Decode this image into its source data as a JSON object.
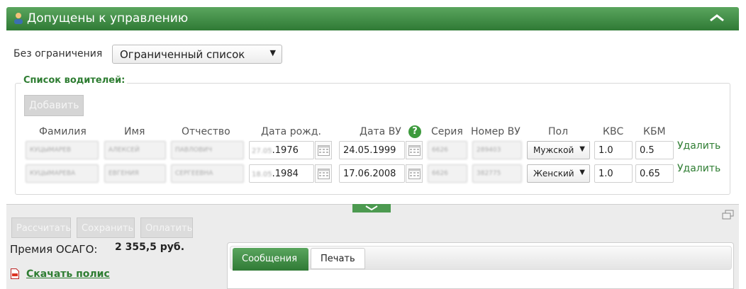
{
  "panel": {
    "title": "Допущены к управлению"
  },
  "restriction": {
    "label": "Без ограничения",
    "selected": "Ограниченный список"
  },
  "drivers": {
    "legend": "Список водителей:",
    "add_label": "Добавить",
    "columns": [
      "Фамилия",
      "Имя",
      "Отчество",
      "Дата рожд.",
      "Дата ВУ",
      "Серия",
      "Номер ВУ",
      "Пол",
      "КВС",
      "КБМ"
    ],
    "rows": [
      {
        "lastname": "КУЦЫМАРЕВ",
        "firstname": "АЛЕКСЕЙ",
        "middlename": "ПАВЛОВИЧ",
        "birth_dm": "27.05",
        "birth_y": ".1976",
        "license_date": "24.05.1999",
        "series": "6626",
        "number": "289403",
        "gender": "Мужской",
        "kvs": "1.0",
        "kbm": "0.5",
        "delete_label": "Удалить"
      },
      {
        "lastname": "КУЦЫМАРЕВА",
        "firstname": "ЕВГЕНИЯ",
        "middlename": "СЕРГЕЕВНА",
        "birth_dm": "18.05",
        "birth_y": ".1984",
        "license_date": "17.06.2008",
        "series": "6626",
        "number": "382775",
        "gender": "Женский",
        "kvs": "1.0",
        "kbm": "0.65",
        "delete_label": "Удалить"
      }
    ]
  },
  "actions": {
    "calculate": "Рассчитать",
    "save": "Сохранить",
    "pay": "Оплатить"
  },
  "premium": {
    "label": "Премия ОСАГО:",
    "value": "2 355,5 руб."
  },
  "download": {
    "label": "Скачать полис"
  },
  "tabs": {
    "messages": "Сообщения",
    "print": "Печать"
  },
  "colors": {
    "accent_green": "#3d8b40",
    "link_green": "#2e7d32"
  }
}
